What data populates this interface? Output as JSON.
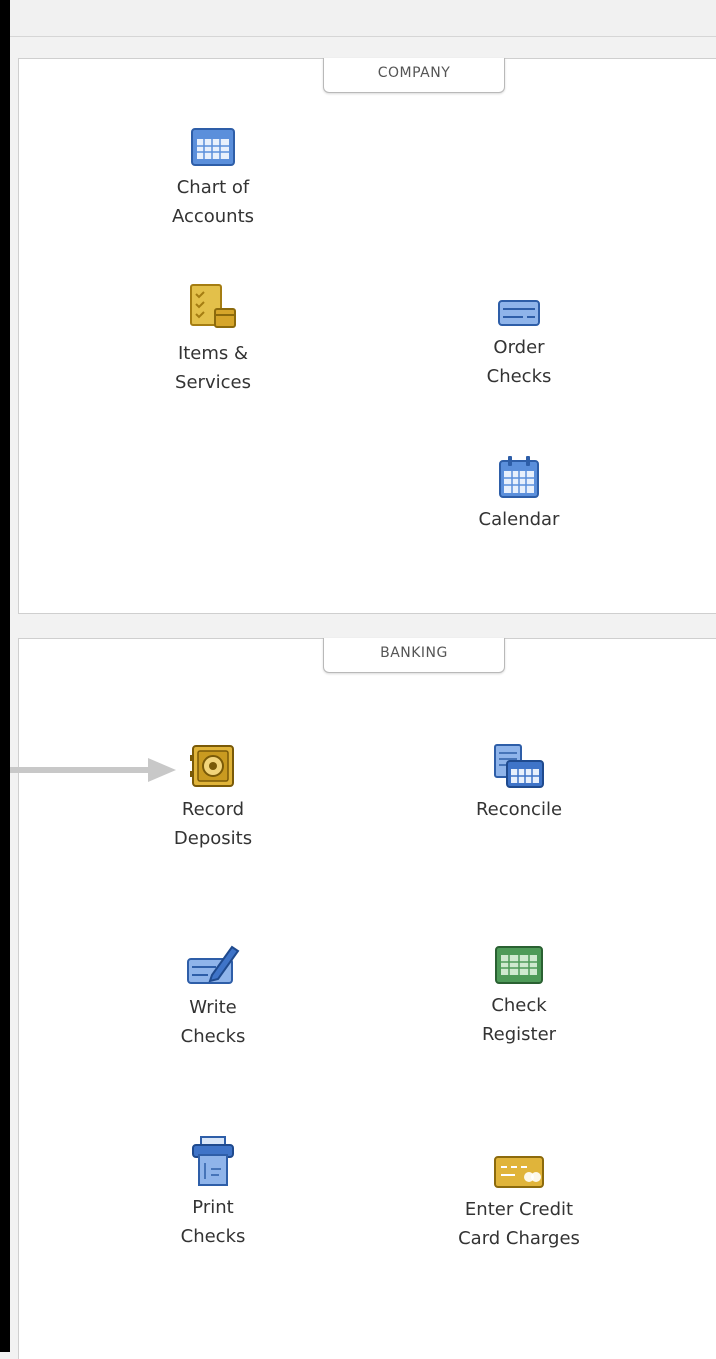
{
  "company": {
    "tab_label": "COMPANY",
    "items": [
      {
        "label": "Chart of\nAccounts",
        "icon": "chart-of-accounts-icon"
      },
      {
        "label": "Items &\nServices",
        "icon": "items-services-icon"
      },
      {
        "label": "Order\nChecks",
        "icon": "order-checks-icon"
      },
      {
        "label": "Calendar",
        "icon": "calendar-icon"
      }
    ]
  },
  "banking": {
    "tab_label": "BANKING",
    "items": [
      {
        "label": "Record\nDeposits",
        "icon": "safe-icon"
      },
      {
        "label": "Reconcile",
        "icon": "reconcile-icon"
      },
      {
        "label": "Write\nChecks",
        "icon": "write-checks-icon"
      },
      {
        "label": "Check\nRegister",
        "icon": "check-register-icon"
      },
      {
        "label": "Print\nChecks",
        "icon": "print-checks-icon"
      },
      {
        "label": "Enter Credit\nCard Charges",
        "icon": "credit-card-icon"
      }
    ]
  },
  "colors": {
    "panel_bg": "#ffffff",
    "page_bg": "#f2f2f2",
    "icon_blue": "#4a7fd0",
    "icon_gold": "#d6a52a",
    "icon_green": "#3e8c4a",
    "arrow_gray": "#c8c8c8"
  }
}
